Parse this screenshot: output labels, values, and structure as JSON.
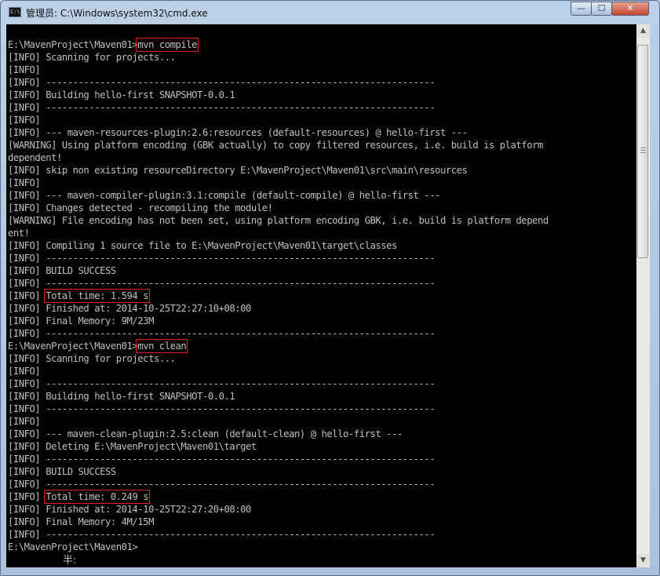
{
  "window": {
    "title": "管理员: C:\\Windows\\system32\\cmd.exe",
    "icon_text": "C:\\",
    "minimize_glyph": "—",
    "maximize_glyph": "☐",
    "close_glyph": "✕"
  },
  "console": {
    "lines": [
      {
        "pre": "E:\\MavenProject\\Maven01>",
        "hl": "mvn compile",
        "post": ""
      },
      {
        "pre": "[INFO] Scanning for projects..."
      },
      {
        "pre": "[INFO]"
      },
      {
        "pre": "[INFO] ------------------------------------------------------------------------"
      },
      {
        "pre": "[INFO] Building hello-first SNAPSHOT-0.0.1"
      },
      {
        "pre": "[INFO] ------------------------------------------------------------------------"
      },
      {
        "pre": "[INFO]"
      },
      {
        "pre": "[INFO] --- maven-resources-plugin:2.6:resources (default-resources) @ hello-first ---"
      },
      {
        "pre": "[WARNING] Using platform encoding (GBK actually) to copy filtered resources, i.e. build is platform"
      },
      {
        "pre": "dependent!"
      },
      {
        "pre": "[INFO] skip non existing resourceDirectory E:\\MavenProject\\Maven01\\src\\main\\resources"
      },
      {
        "pre": "[INFO]"
      },
      {
        "pre": "[INFO] --- maven-compiler-plugin:3.1:compile (default-compile) @ hello-first ---"
      },
      {
        "pre": "[INFO] Changes detected - recompiling the module!"
      },
      {
        "pre": "[WARNING] File encoding has not been set, using platform encoding GBK, i.e. build is platform depend"
      },
      {
        "pre": "ent!"
      },
      {
        "pre": "[INFO] Compiling 1 source file to E:\\MavenProject\\Maven01\\target\\classes"
      },
      {
        "pre": "[INFO] ------------------------------------------------------------------------"
      },
      {
        "pre": "[INFO] BUILD SUCCESS"
      },
      {
        "pre": "[INFO] ------------------------------------------------------------------------"
      },
      {
        "pre": "[INFO] ",
        "hl": "Total time: 1.594 s",
        "post": ""
      },
      {
        "pre": "[INFO] Finished at: 2014-10-25T22:27:10+08:00"
      },
      {
        "pre": "[INFO] Final Memory: 9M/23M"
      },
      {
        "pre": "[INFO] ------------------------------------------------------------------------"
      },
      {
        "pre": "E:\\MavenProject\\Maven01>",
        "hl": "mvn clean",
        "post": ""
      },
      {
        "pre": "[INFO] Scanning for projects..."
      },
      {
        "pre": "[INFO]"
      },
      {
        "pre": "[INFO] ------------------------------------------------------------------------"
      },
      {
        "pre": "[INFO] Building hello-first SNAPSHOT-0.0.1"
      },
      {
        "pre": "[INFO] ------------------------------------------------------------------------"
      },
      {
        "pre": "[INFO]"
      },
      {
        "pre": "[INFO] --- maven-clean-plugin:2.5:clean (default-clean) @ hello-first ---"
      },
      {
        "pre": "[INFO] Deleting E:\\MavenProject\\Maven01\\target"
      },
      {
        "pre": "[INFO] ------------------------------------------------------------------------"
      },
      {
        "pre": "[INFO] BUILD SUCCESS"
      },
      {
        "pre": "[INFO] ------------------------------------------------------------------------"
      },
      {
        "pre": "[INFO] ",
        "hl": "Total time: 0.249 s",
        "post": ""
      },
      {
        "pre": "[INFO] Finished at: 2014-10-25T22:27:20+08:00"
      },
      {
        "pre": "[INFO] Final Memory: 4M/15M"
      },
      {
        "pre": "[INFO] ------------------------------------------------------------------------"
      },
      {
        "pre": "E:\\MavenProject\\Maven01>"
      }
    ],
    "ime_text": "半:"
  },
  "scrollbar": {
    "up_glyph": "▲",
    "down_glyph": "▼"
  }
}
